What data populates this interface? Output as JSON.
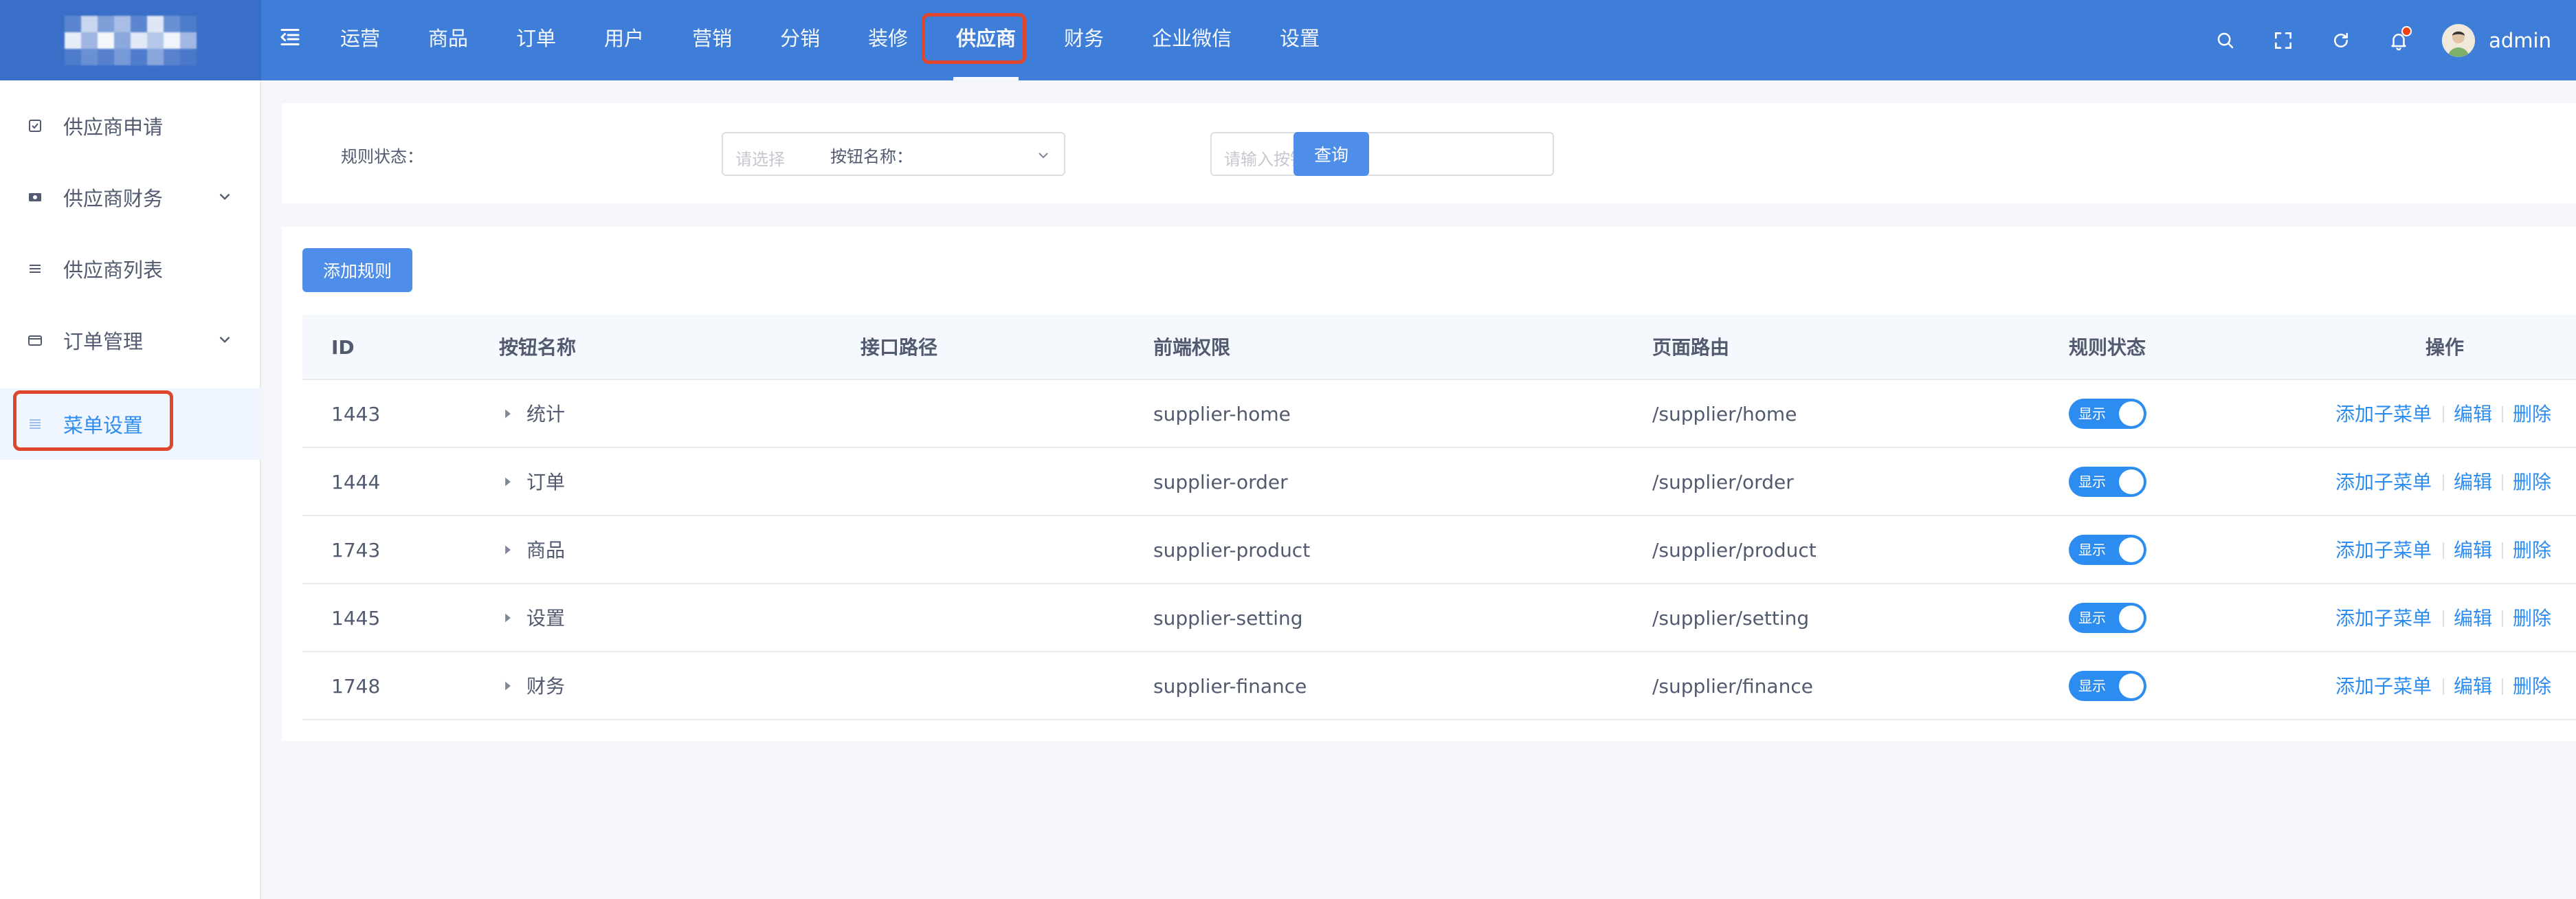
{
  "colors": {
    "header_bg": "#3f7ed8",
    "primary": "#2d8cf0",
    "button": "#4f8ee8",
    "highlight_box": "#e0462c"
  },
  "header": {
    "logo_alt": "logo (pixelated)",
    "nav_items": [
      "运营",
      "商品",
      "订单",
      "用户",
      "营销",
      "分销",
      "装修",
      "供应商",
      "财务",
      "企业微信",
      "设置"
    ],
    "active_nav": "供应商",
    "icons": [
      "search-icon",
      "fullscreen-icon",
      "refresh-icon",
      "bell-icon"
    ],
    "username": "admin"
  },
  "sidebar": {
    "items": [
      {
        "label": "供应商申请",
        "icon": "checkbox-icon",
        "expandable": false
      },
      {
        "label": "供应商财务",
        "icon": "card-icon",
        "expandable": true
      },
      {
        "label": "供应商列表",
        "icon": "list-icon",
        "expandable": false
      },
      {
        "label": "订单管理",
        "icon": "box-icon",
        "expandable": true
      },
      {
        "label": "菜单设置",
        "icon": "menu-icon",
        "expandable": false,
        "active": true
      }
    ]
  },
  "search": {
    "status_label": "规则状态：",
    "status_placeholder": "请选择",
    "name_label": "按钮名称：",
    "name_placeholder": "请输入按钮名称",
    "query_button": "查询"
  },
  "table": {
    "add_button": "添加规则",
    "columns": [
      "ID",
      "按钮名称",
      "接口路径",
      "前端权限",
      "页面路由",
      "规则状态",
      "操作"
    ],
    "rows": [
      {
        "id": "1443",
        "name": "统计",
        "api": "",
        "perm": "supplier-home",
        "route": "/supplier/home",
        "status": "显示"
      },
      {
        "id": "1444",
        "name": "订单",
        "api": "",
        "perm": "supplier-order",
        "route": "/supplier/order",
        "status": "显示"
      },
      {
        "id": "1743",
        "name": "商品",
        "api": "",
        "perm": "supplier-product",
        "route": "/supplier/product",
        "status": "显示"
      },
      {
        "id": "1445",
        "name": "设置",
        "api": "",
        "perm": "supplier-setting",
        "route": "/supplier/setting",
        "status": "显示"
      },
      {
        "id": "1748",
        "name": "财务",
        "api": "",
        "perm": "supplier-finance",
        "route": "/supplier/finance",
        "status": "显示"
      }
    ],
    "actions": [
      "添加子菜单",
      "编辑",
      "删除"
    ]
  }
}
